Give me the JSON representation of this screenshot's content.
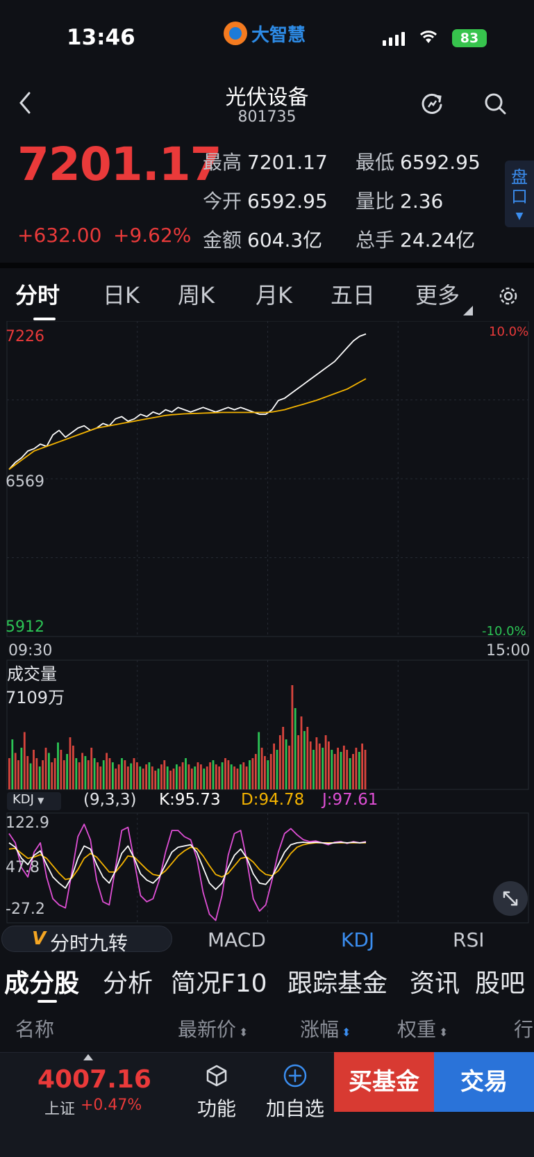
{
  "status_bar": {
    "time": "13:46",
    "app_name": "大智慧",
    "battery": "83"
  },
  "header": {
    "title": "光伏设备",
    "code": "801735"
  },
  "quote": {
    "price": "7201.17",
    "change": "+632.00",
    "change_pct": "+9.62%",
    "stats": [
      {
        "label": "最高",
        "value": "7201.17"
      },
      {
        "label": "最低",
        "value": "6592.95"
      },
      {
        "label": "今开",
        "value": "6592.95"
      },
      {
        "label": "量比",
        "value": "2.36"
      },
      {
        "label": "金额",
        "value": "604.3亿"
      },
      {
        "label": "总手",
        "value": "24.24亿"
      }
    ],
    "panel_button": "盘口"
  },
  "period_tabs": [
    "分时",
    "日K",
    "周K",
    "月K",
    "五日",
    "更多"
  ],
  "chart_data": {
    "type": "line",
    "title": "",
    "x_range": [
      "09:30",
      "15:00"
    ],
    "price_axis": {
      "top": "7226",
      "mid": "6569",
      "bottom": "5912",
      "top_pct": "10.0%",
      "bottom_pct": "-10.0%"
    },
    "series": [
      {
        "name": "price",
        "color": "#ffffff",
        "values": [
          6610,
          6640,
          6660,
          6690,
          6700,
          6720,
          6710,
          6760,
          6780,
          6750,
          6770,
          6790,
          6800,
          6780,
          6790,
          6810,
          6800,
          6830,
          6840,
          6820,
          6830,
          6850,
          6840,
          6860,
          6850,
          6870,
          6860,
          6880,
          6870,
          6860,
          6870,
          6880,
          6870,
          6860,
          6870,
          6880,
          6870,
          6880,
          6870,
          6860,
          6850,
          6850,
          6870,
          6910,
          6920,
          6940,
          6960,
          6980,
          7000,
          7020,
          7040,
          7060,
          7080,
          7110,
          7140,
          7170,
          7190,
          7200
        ]
      },
      {
        "name": "avg",
        "color": "#f5b400",
        "values": [
          6610,
          6630,
          6650,
          6670,
          6690,
          6700,
          6710,
          6720,
          6730,
          6740,
          6750,
          6760,
          6770,
          6780,
          6790,
          6795,
          6800,
          6805,
          6810,
          6815,
          6820,
          6825,
          6830,
          6835,
          6840,
          6845,
          6848,
          6850,
          6852,
          6853,
          6854,
          6855,
          6856,
          6857,
          6858,
          6858,
          6858,
          6858,
          6858,
          6858,
          6858,
          6858,
          6860,
          6865,
          6870,
          6878,
          6886,
          6894,
          6902,
          6910,
          6920,
          6930,
          6940,
          6950,
          6960,
          6975,
          6990,
          7005
        ]
      }
    ],
    "volume": {
      "label": "成交量",
      "max_label": "7109万",
      "values": [
        30,
        48,
        35,
        28,
        40,
        55,
        32,
        25,
        38,
        30,
        22,
        28,
        40,
        35,
        26,
        30,
        45,
        38,
        28,
        34,
        50,
        42,
        30,
        26,
        35,
        32,
        28,
        40,
        30,
        26,
        22,
        28,
        35,
        30,
        26,
        20,
        24,
        30,
        28,
        22,
        25,
        30,
        26,
        22,
        20,
        24,
        26,
        22,
        18,
        20,
        24,
        28,
        22,
        18,
        20,
        24,
        22,
        26,
        30,
        24,
        20,
        22,
        26,
        24,
        20,
        22,
        26,
        28,
        24,
        22,
        26,
        30,
        28,
        24,
        22,
        20,
        24,
        26,
        22,
        28,
        30,
        34,
        55,
        40,
        32,
        28,
        34,
        44,
        38,
        52,
        60,
        48,
        42,
        100,
        78,
        52,
        70,
        56,
        60,
        46,
        38,
        50,
        44,
        40,
        52,
        46,
        38,
        34,
        40,
        36,
        42,
        38,
        30,
        34,
        40,
        36,
        44,
        38
      ]
    },
    "kdj": {
      "label": "KDJ",
      "params": "(9,3,3)",
      "k": "K:95.73",
      "d": "D:94.78",
      "j": "J:97.61",
      "axis": [
        "122.9",
        "47.8",
        "-27.2"
      ],
      "k_values": [
        95,
        88,
        70,
        60,
        75,
        82,
        60,
        40,
        30,
        22,
        40,
        70,
        90,
        85,
        60,
        40,
        30,
        50,
        78,
        90,
        70,
        45,
        35,
        30,
        40,
        60,
        80,
        88,
        90,
        92,
        80,
        55,
        30,
        20,
        30,
        55,
        75,
        85,
        70,
        45,
        30,
        28,
        40,
        60,
        80,
        92,
        95,
        96,
        95,
        96,
        95,
        94,
        95,
        96,
        95,
        96,
        95,
        96
      ],
      "d_values": [
        85,
        86,
        78,
        70,
        72,
        76,
        70,
        58,
        46,
        36,
        38,
        52,
        70,
        78,
        72,
        60,
        48,
        48,
        60,
        74,
        72,
        62,
        52,
        44,
        42,
        50,
        62,
        74,
        82,
        88,
        86,
        74,
        58,
        44,
        40,
        46,
        58,
        70,
        72,
        64,
        52,
        44,
        42,
        50,
        64,
        78,
        88,
        92,
        94,
        95,
        95,
        95,
        95,
        95,
        95,
        95,
        95,
        95
      ],
      "j_values": [
        110,
        95,
        55,
        40,
        80,
        95,
        40,
        5,
        -5,
        -10,
        45,
        105,
        125,
        100,
        35,
        0,
        -5,
        55,
        115,
        120,
        65,
        10,
        0,
        5,
        35,
        80,
        115,
        115,
        105,
        100,
        70,
        15,
        -20,
        -30,
        10,
        75,
        110,
        115,
        65,
        5,
        -15,
        -5,
        35,
        80,
        110,
        118,
        108,
        100,
        97,
        98,
        95,
        92,
        96,
        97,
        94,
        97,
        95,
        97
      ]
    },
    "indicator_tabs": [
      "分时九转",
      "MACD",
      "KDJ",
      "RSI"
    ],
    "indicator_active": "KDJ"
  },
  "sub_tabs": [
    "成分股",
    "分析",
    "简况F10",
    "跟踪基金",
    "资讯",
    "股吧"
  ],
  "table_headers": [
    "名称",
    "最新价",
    "涨幅",
    "权重",
    "行"
  ],
  "bottom_bar": {
    "index_price": "4007.16",
    "index_name": "上证",
    "index_pct": "+0.47%",
    "func_label": "功能",
    "watch_label": "加自选",
    "buy_fund": "买基金",
    "trade": "交易"
  }
}
